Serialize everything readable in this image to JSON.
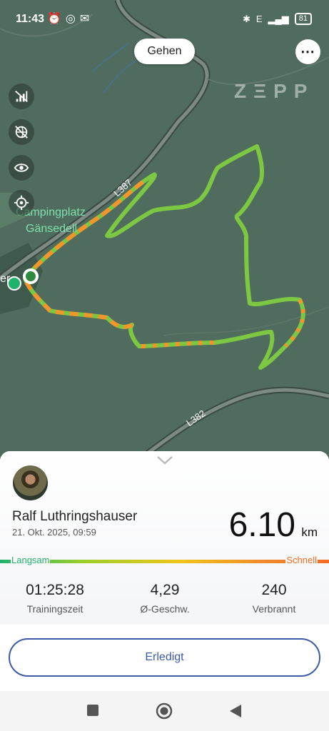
{
  "status": {
    "time": "11:43",
    "left_icons": [
      "alarm-icon",
      "whatsapp-icon",
      "gmail-icon"
    ],
    "network": "E",
    "battery": "81"
  },
  "map": {
    "activity_label": "Gehen",
    "more_label": "⋯",
    "brand": "ZEPP",
    "road_labels": [
      "L387",
      "L382"
    ],
    "place_label": "Campingplatz Gänsedell",
    "place_line1": "Campingplatz",
    "place_line2": "Gänsedell",
    "edge_label": "er",
    "controls": [
      "signal-off-icon",
      "globe-off-icon",
      "eye-icon",
      "locate-icon"
    ]
  },
  "summary": {
    "user_name": "Ralf Luthringshauser",
    "date": "21. Okt. 2025, 09:59",
    "distance": "6.10",
    "distance_unit": "km",
    "speed_slow": "Langsam",
    "speed_fast": "Schnell",
    "stats": [
      {
        "value": "01:25:28",
        "label": "Trainingszeit"
      },
      {
        "value": "4,29",
        "label": "Ø-Geschw."
      },
      {
        "value": "240",
        "label": "Verbrannt"
      }
    ],
    "done_label": "Erledigt"
  },
  "colors": {
    "route_green": "#7dc843",
    "route_orange": "#f0962a",
    "accent_blue": "#3d5aa8"
  }
}
